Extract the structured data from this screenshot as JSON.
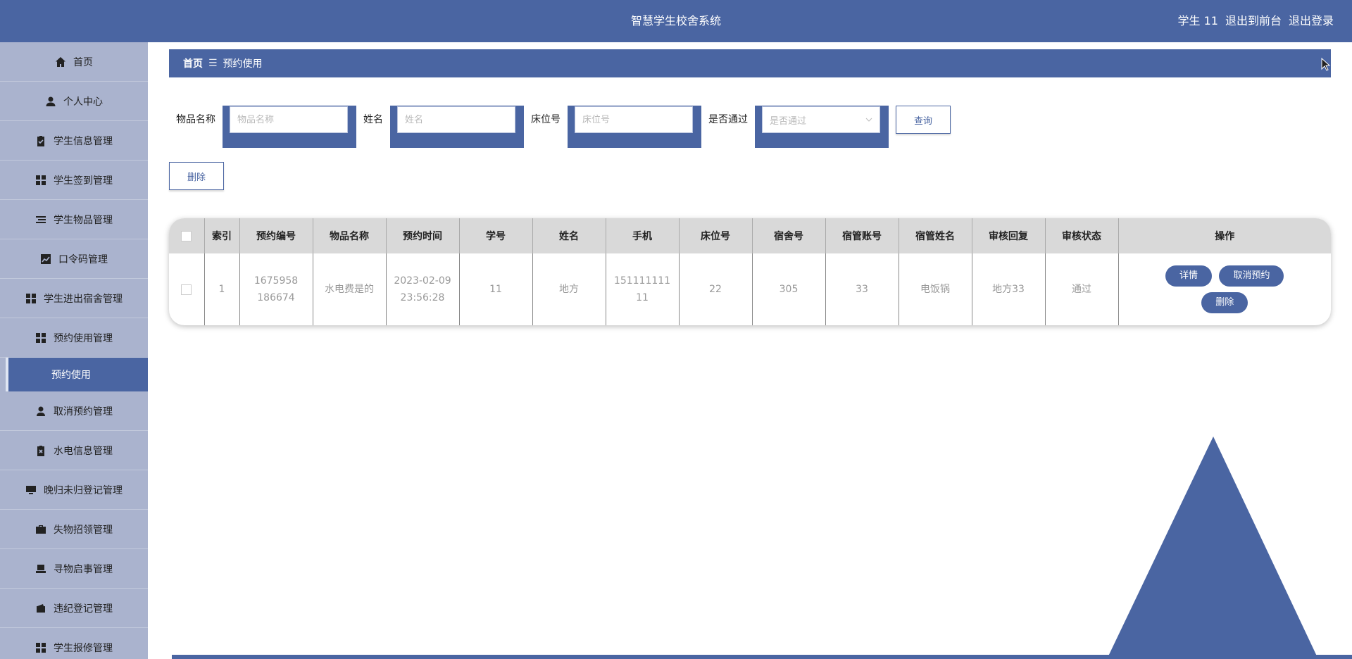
{
  "header": {
    "title": "智慧学生校舍系统",
    "user": "学生 11",
    "exit_front": "退出到前台",
    "logout": "退出登录"
  },
  "sidebar": {
    "items": [
      {
        "label": "首页",
        "icon": "home-icon"
      },
      {
        "label": "个人中心",
        "icon": "user-icon"
      },
      {
        "label": "学生信息管理",
        "icon": "clipboard-check-icon"
      },
      {
        "label": "学生签到管理",
        "icon": "grid-icon"
      },
      {
        "label": "学生物品管理",
        "icon": "list-icon"
      },
      {
        "label": "口令码管理",
        "icon": "chart-icon"
      },
      {
        "label": "学生进出宿舍管理",
        "icon": "grid-icon"
      },
      {
        "label": "预约使用管理",
        "icon": "grid-icon"
      },
      {
        "label": "取消预约管理",
        "icon": "user-icon"
      },
      {
        "label": "水电信息管理",
        "icon": "clipboard-x-icon"
      },
      {
        "label": "晚归未归登记管理",
        "icon": "monitor-icon"
      },
      {
        "label": "失物招领管理",
        "icon": "briefcase-icon"
      },
      {
        "label": "寻物启事管理",
        "icon": "laptop-icon"
      },
      {
        "label": "违纪登记管理",
        "icon": "wallet-icon"
      },
      {
        "label": "学生报修管理",
        "icon": "grid-icon"
      }
    ],
    "active_sub": "预约使用"
  },
  "breadcrumb": {
    "home": "首页",
    "separator": "☰",
    "current": "预约使用"
  },
  "filters": {
    "item_name_label": "物品名称",
    "item_name_placeholder": "物品名称",
    "name_label": "姓名",
    "name_placeholder": "姓名",
    "bed_label": "床位号",
    "bed_placeholder": "床位号",
    "passed_label": "是否通过",
    "passed_placeholder": "是否通过",
    "query_label": "查询"
  },
  "actions": {
    "delete_label": "删除"
  },
  "table": {
    "headers": [
      "索引",
      "预约编号",
      "物品名称",
      "预约时间",
      "学号",
      "姓名",
      "手机",
      "床位号",
      "宿舍号",
      "宿管账号",
      "宿管姓名",
      "审核回复",
      "审核状态",
      "操作"
    ],
    "rows": [
      {
        "index": "1",
        "booking_no": "1675958186674",
        "item_name": "水电费是的",
        "booking_time": "2023-02-09 23:56:28",
        "student_no": "11",
        "name": "地方",
        "phone": "15111111111",
        "bed_no": "22",
        "dorm_no": "305",
        "manager_account": "33",
        "manager_name": "电饭锅",
        "review_reply": "地方33",
        "review_status": "通过"
      }
    ],
    "row_actions": {
      "detail": "详情",
      "cancel": "取消预约",
      "delete": "删除"
    }
  },
  "colors": {
    "primary": "#4a65a2",
    "sidebar_bg": "#aab3ce",
    "header_row_bg": "#d9d9d9"
  }
}
